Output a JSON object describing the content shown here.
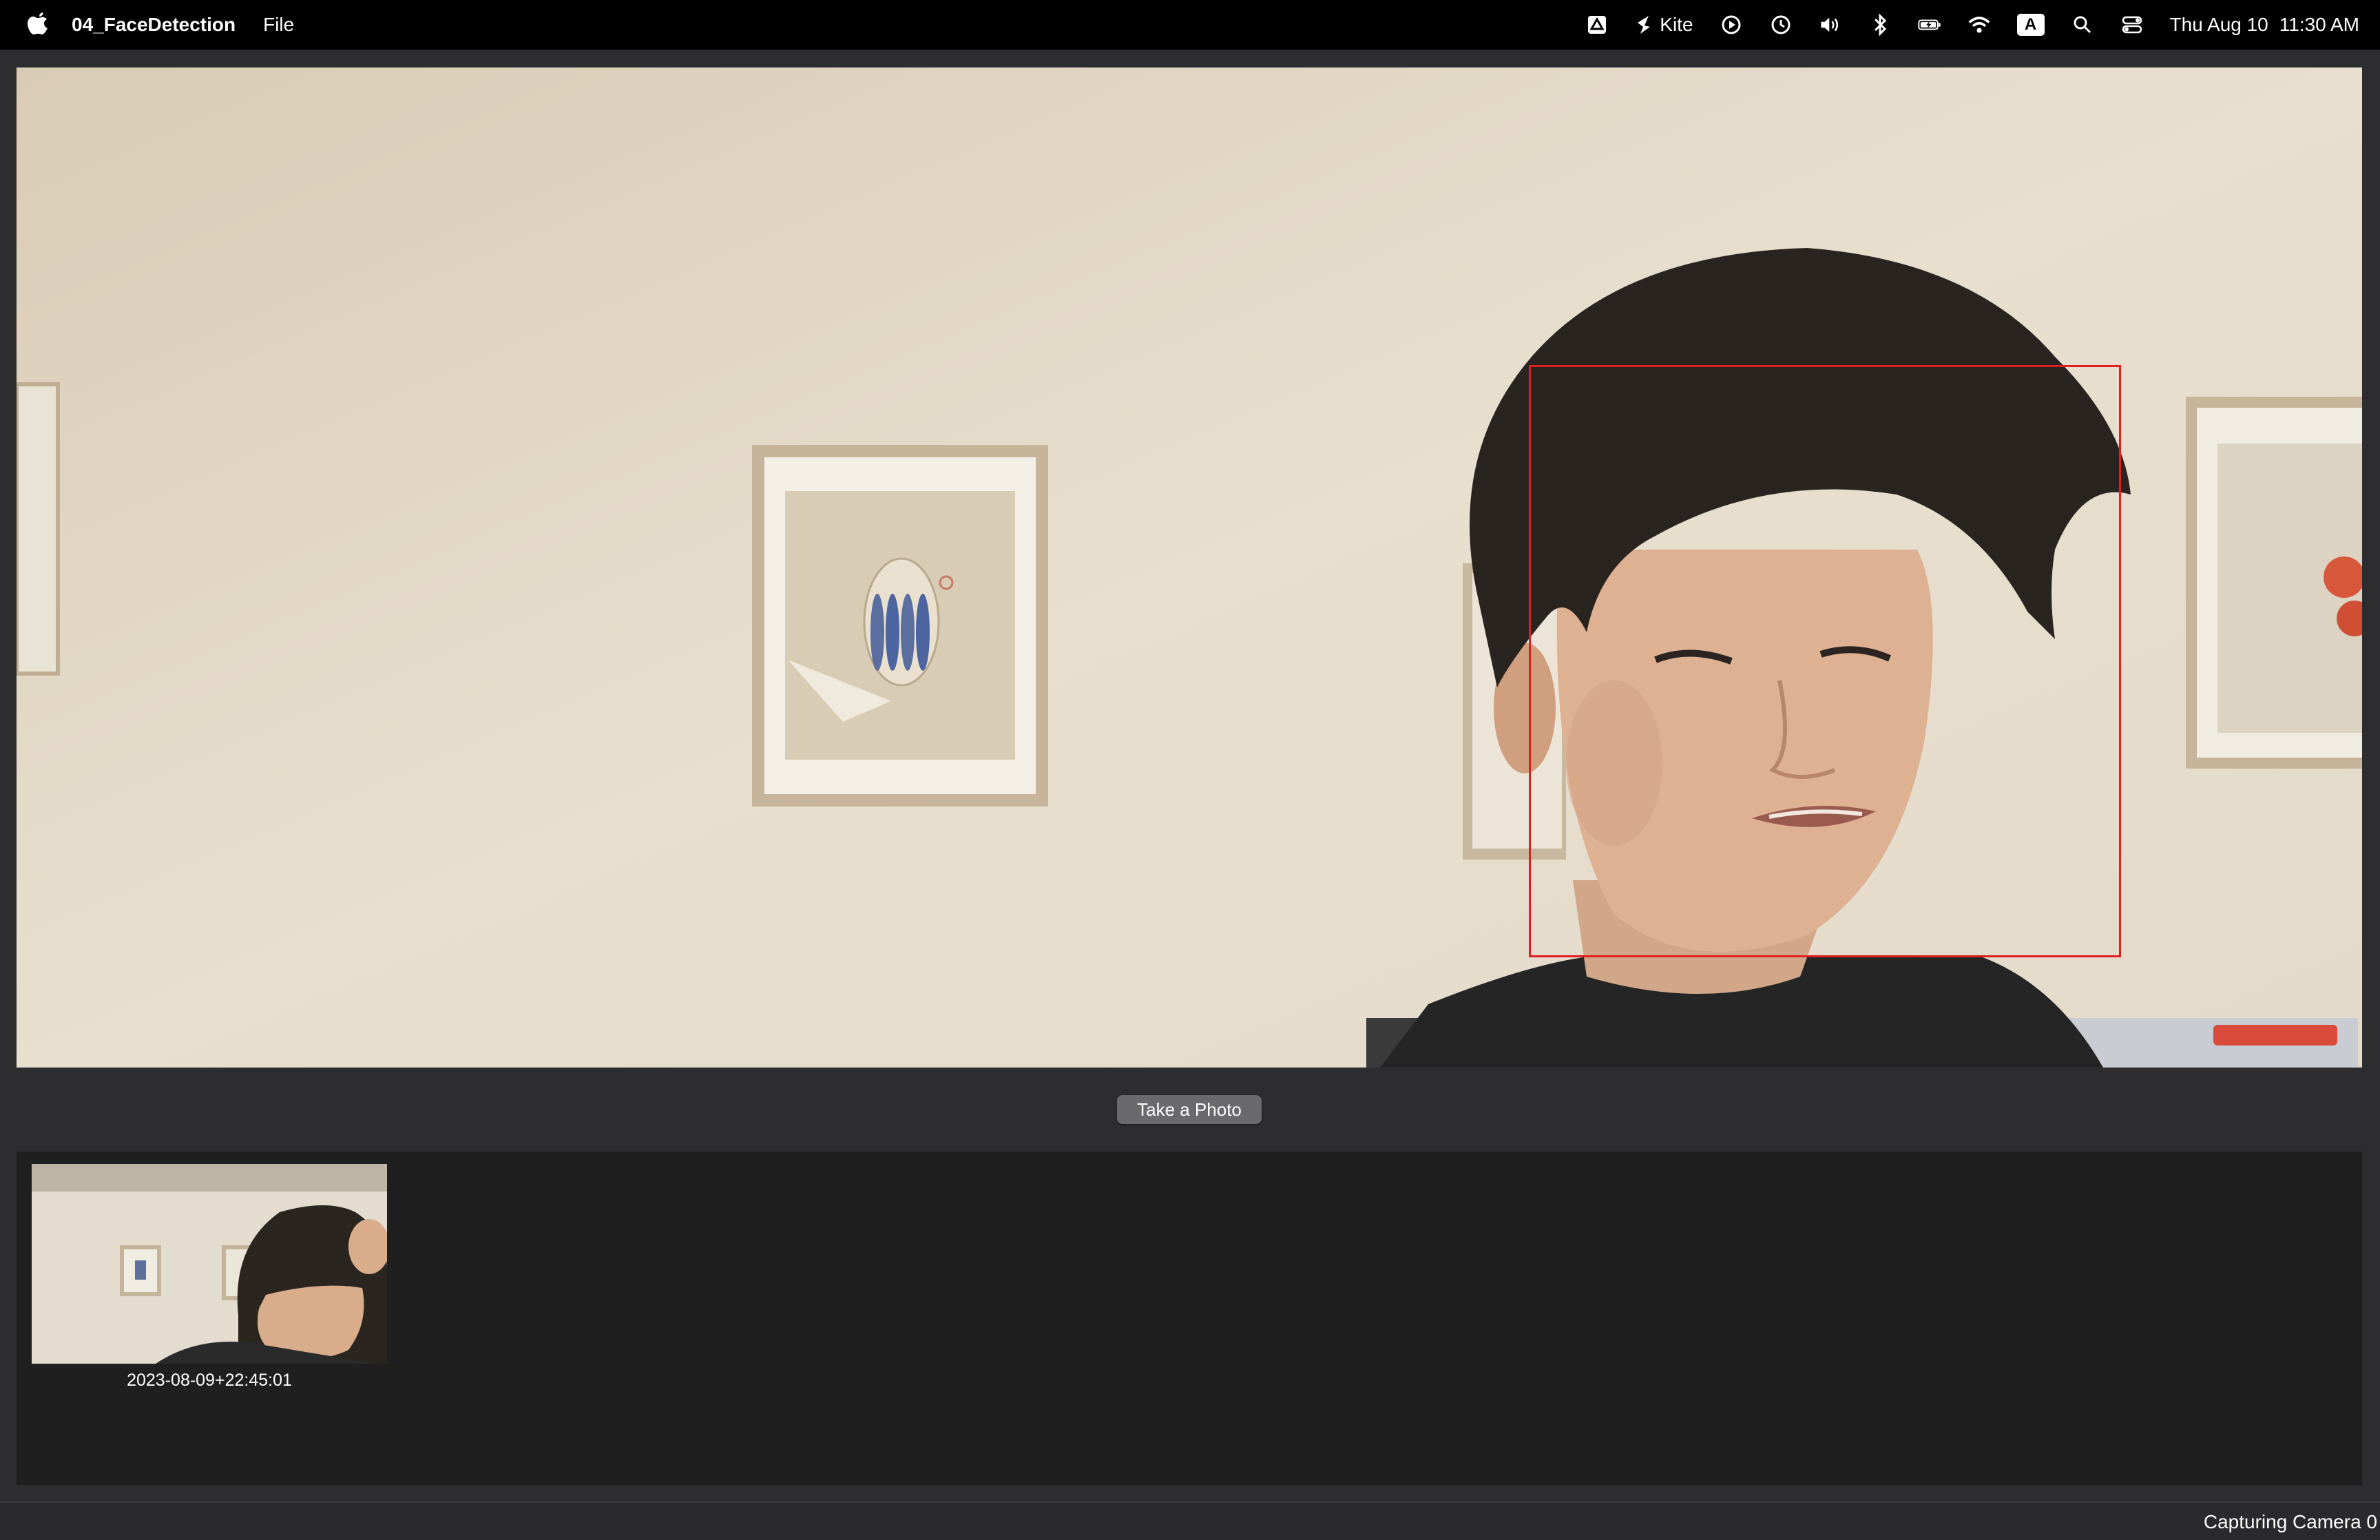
{
  "menubar": {
    "app_name": "04_FaceDetection",
    "menus": [
      "File"
    ],
    "status_items": {
      "kite_label": "Kite",
      "input_source": "A",
      "date": "Thu Aug 10",
      "time": "11:30 AM"
    }
  },
  "camera": {
    "face_detection_color": "#e01f1f"
  },
  "controls": {
    "take_photo_label": "Take a Photo"
  },
  "gallery": {
    "photos": [
      {
        "label": "2023-08-09+22:45:01"
      }
    ]
  },
  "statusbar": {
    "text": "Capturing Camera 0"
  }
}
